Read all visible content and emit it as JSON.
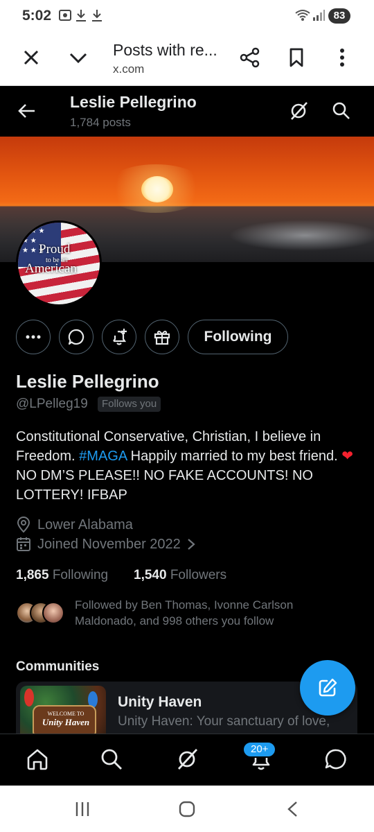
{
  "status_bar": {
    "time": "5:02",
    "battery": "83"
  },
  "browser": {
    "title": "Posts with re...",
    "url": "x.com"
  },
  "header": {
    "name": "Leslie Pellegrino",
    "posts": "1,784 posts"
  },
  "banner_avatar": {
    "avatar_text_1": "Proud",
    "avatar_text_2": "to be an",
    "avatar_text_3": "American"
  },
  "actions": {
    "following_label": "Following"
  },
  "profile": {
    "name": "Leslie Pellegrino",
    "handle": "@LPelleg19",
    "follows_you": "Follows you",
    "bio_part1": "Constitutional Conservative, Christian, I believe in Freedom. ",
    "bio_hashtag": "#MAGA",
    "bio_part2": "  Happily married to my best friend. ",
    "bio_heart": "❤",
    "bio_part3": " NO DM’S PLEASE!! NO FAKE ACCOUNTS! NO LOTTERY! IFBAP",
    "location": "Lower Alabama",
    "joined": "Joined November 2022",
    "following_count": "1,865",
    "following_label": "Following",
    "followers_count": "1,540",
    "followers_label": "Followers",
    "followed_by": "Followed by Ben Thomas, Ivonne Carlson Maldonado, and 998 others you follow"
  },
  "communities": {
    "heading": "Communities",
    "card": {
      "image_text_1": "WELCOME TO",
      "image_text_2": "Unity Haven",
      "name": "Unity Haven",
      "description": "Unity Haven: Your sanctuary of love,"
    }
  },
  "bottom_nav": {
    "notifications_badge": "20+"
  },
  "colors": {
    "accent": "#1d9bf0",
    "background": "#000000",
    "secondary_text": "#71767b",
    "heart": "#f4212e"
  }
}
